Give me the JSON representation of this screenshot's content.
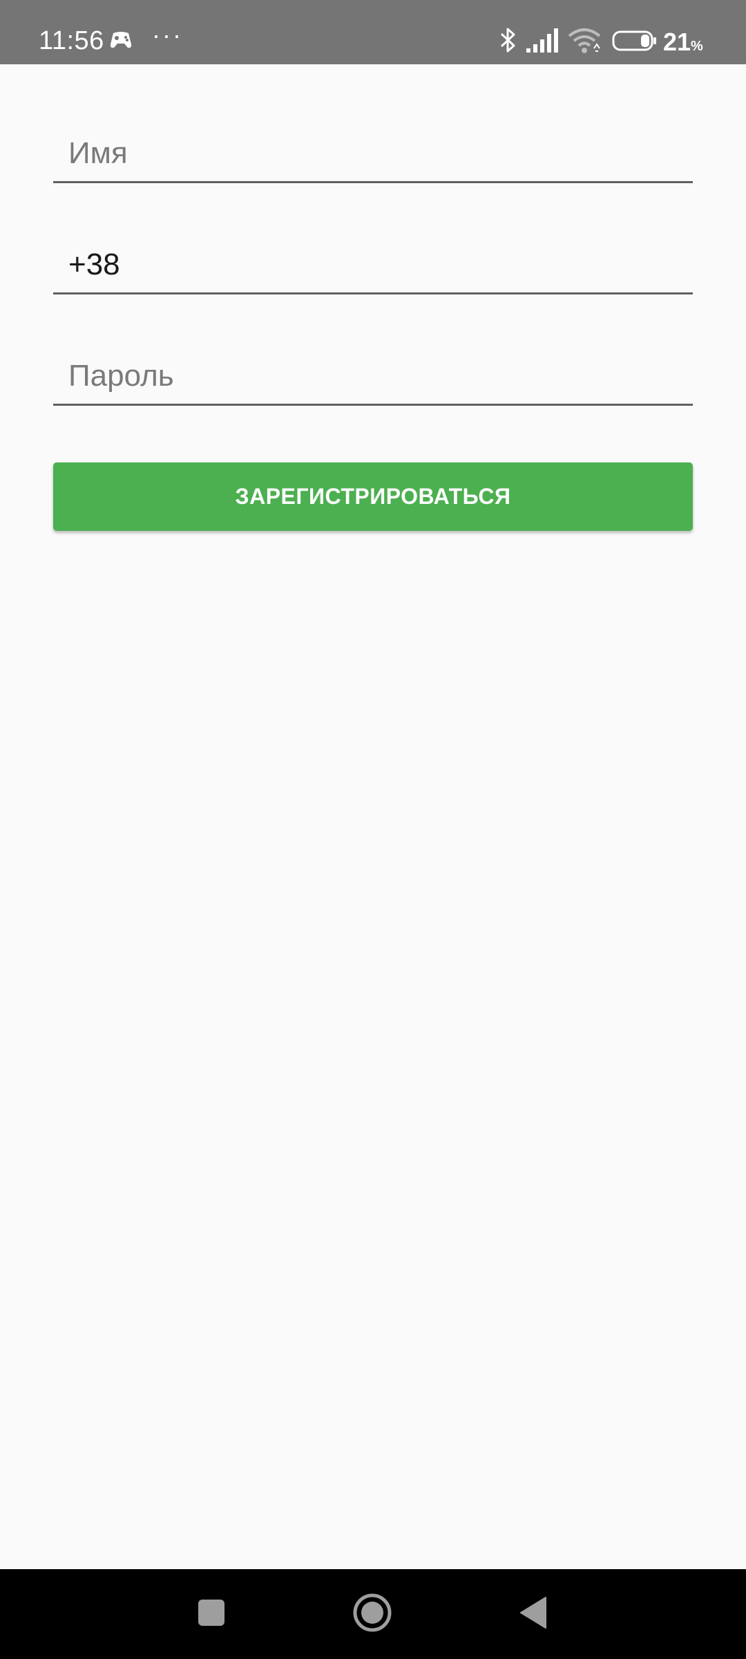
{
  "status_bar": {
    "time": "11:56",
    "more": "···",
    "battery_level": "21",
    "battery_unit": "%",
    "icons": [
      "game-controller-icon",
      "bluetooth-icon",
      "signal-icon",
      "wifi-icon",
      "battery-icon"
    ]
  },
  "form": {
    "name_placeholder": "Имя",
    "name_value": "",
    "phone_value": "+38",
    "password_placeholder": "Пароль",
    "password_value": "",
    "register_label": "ЗАРЕГИСТРИРОВАТЬСЯ"
  },
  "colors": {
    "status_bar_bg": "#757575",
    "background": "#fafafa",
    "accent_button": "#4caf50",
    "nav_bar_bg": "#000000"
  },
  "nav_bar": {
    "icons": [
      "recents-icon",
      "home-icon",
      "back-icon"
    ]
  }
}
